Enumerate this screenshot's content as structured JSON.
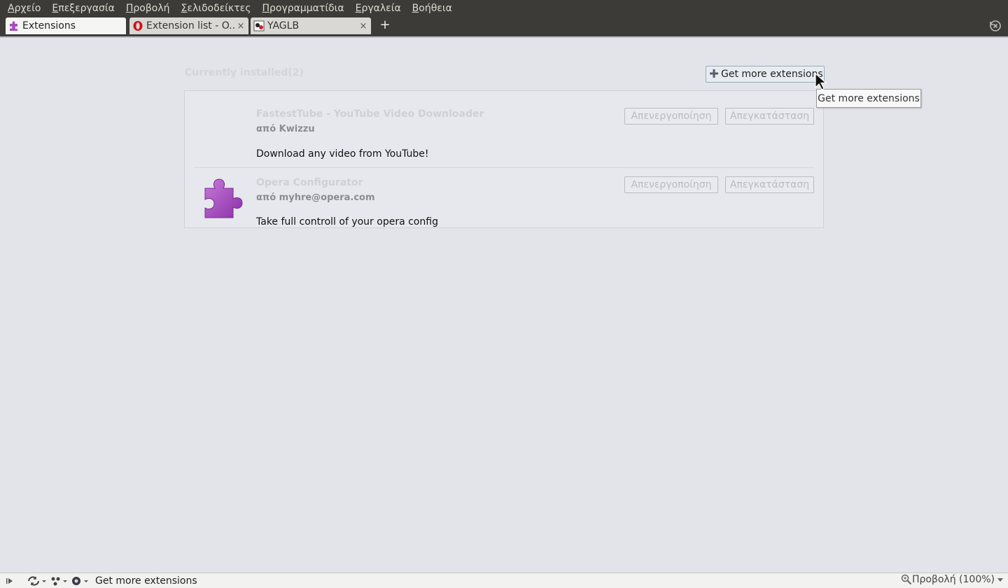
{
  "menubar": {
    "items": [
      {
        "label": "Αρχείο",
        "accel": "Α",
        "rest": "ρχείο"
      },
      {
        "label": "Επεξεργασία",
        "accel": "Ε",
        "rest": "πεξεργασία"
      },
      {
        "label": "Προβολή",
        "accel": "Π",
        "rest": "ροβολή"
      },
      {
        "label": "Σελιδοδείκτες",
        "accel": "Σ",
        "rest": "ελιδοδείκτες"
      },
      {
        "label": "Προγραμματίδια",
        "accel": "Π",
        "rest": "ρογραμματίδια"
      },
      {
        "label": "Εργαλεία",
        "accel": "Ε",
        "rest": "ργαλεία"
      },
      {
        "label": "Βοήθεια",
        "accel": "Β",
        "rest": "οήθεια"
      }
    ]
  },
  "tabs": [
    {
      "title": "Extensions",
      "icon": "puzzle-icon",
      "active": true
    },
    {
      "title": "Extension list - O...",
      "icon": "opera-icon",
      "active": false,
      "close": "×"
    },
    {
      "title": "YAGLB",
      "icon": "yaglb-icon",
      "active": false,
      "close": "×"
    }
  ],
  "tabbar": {
    "add_label": "+"
  },
  "content": {
    "heading": "Currently installed(2)",
    "get_more_label": "Get more extensions",
    "tooltip": "Get more extensions",
    "extensions": [
      {
        "name": "FastestTube - YouTube Video Downloader",
        "author": "από Kwizzu",
        "description": "Download any video from YouTube!",
        "disable_label": "Απενεργοποίηση",
        "uninstall_label": "Απεγκατάσταση"
      },
      {
        "name": "Opera Configurator",
        "author": "από myhre@opera.com",
        "description": "Take full controll of your opera config",
        "disable_label": "Απενεργοποίηση",
        "uninstall_label": "Απεγκατάσταση"
      }
    ]
  },
  "statusbar": {
    "text": "Get more extensions",
    "zoom": "Προβολή (100%)"
  },
  "colors": {
    "menubar_bg": "#3c3b37",
    "content_bg": "#e3e4ea",
    "puzzle_purple": "#a64bbf"
  }
}
